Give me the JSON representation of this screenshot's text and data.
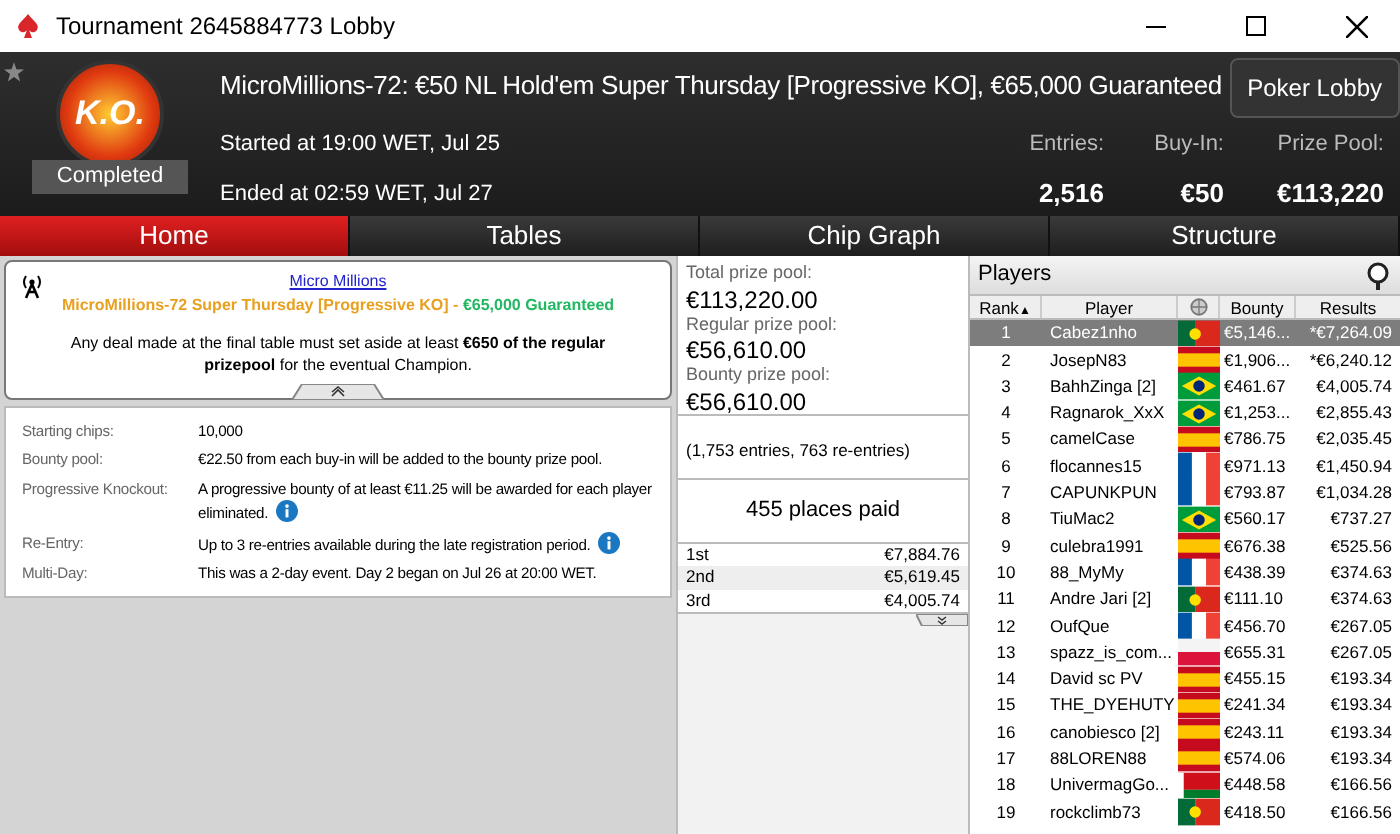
{
  "window": {
    "title": "Tournament 2645884773 Lobby"
  },
  "header": {
    "badge": "K.O.",
    "status": "Completed",
    "title": "MicroMillions-72: €50 NL Hold'em Super Thursday [Progressive KO], €65,000 Guaranteed",
    "started": "Started at 19:00 WET, Jul 25",
    "ended": "Ended at 02:59 WET, Jul 27",
    "lobby_button": "Poker Lobby",
    "stats": [
      {
        "label": "Entries:",
        "value": "2,516"
      },
      {
        "label": "Buy-In:",
        "value": "€50"
      },
      {
        "label": "Prize Pool:",
        "value": "€113,220"
      }
    ]
  },
  "tabs": [
    {
      "label": "Home",
      "selected": true
    },
    {
      "label": "Tables",
      "selected": false
    },
    {
      "label": "Chip Graph",
      "selected": false
    },
    {
      "label": "Structure",
      "selected": false
    }
  ],
  "banner": {
    "link": "Micro Millions",
    "name": "MicroMillions-72 Super Thursday [Progressive KO]",
    "separator": " - ",
    "guarantee": "€65,000 Guaranteed",
    "note": "Any deal made at the final table must set aside at least **€650 of the regular prizepool** for the eventual Champion."
  },
  "details": [
    {
      "label": "Starting chips:",
      "value": "10,000",
      "info": false
    },
    {
      "label": "Bounty pool:",
      "value": "€22.50 from each buy-in will be added to the bounty prize pool.",
      "info": false
    },
    {
      "label": "Progressive Knockout:",
      "value": "A progressive bounty of at least €11.25 will be awarded for each player eliminated.",
      "info": true
    },
    {
      "label": "Re-Entry:",
      "value": "Up to 3 re-entries available during the late registration period.",
      "info": true
    },
    {
      "label": "Multi-Day:",
      "value": "This was a 2-day event. Day 2 began on Jul 26 at 20:00 WET.",
      "info": false
    }
  ],
  "prizes": {
    "pools": [
      {
        "label": "Total prize pool:",
        "value": "€113,220.00"
      },
      {
        "label": "Regular prize pool:",
        "value": "€56,610.00"
      },
      {
        "label": "Bounty prize pool:",
        "value": "€56,610.00"
      }
    ],
    "entries_note": "(1,753 entries, 763 re-entries)",
    "places_paid": "455 places paid",
    "payouts": [
      {
        "place": "1st",
        "amount": "€7,884.76"
      },
      {
        "place": "2nd",
        "amount": "€5,619.45"
      },
      {
        "place": "3rd",
        "amount": "€4,005.74"
      }
    ]
  },
  "players": {
    "title": "Players",
    "columns": [
      "Rank",
      "Player",
      "Bounty",
      "Results"
    ],
    "sort_indicator": "▲",
    "rows": [
      {
        "rank": "1",
        "name": "Cabez1nho",
        "kind": "pt",
        "bounty": "€5,146...",
        "result": "*€7,264.09",
        "selected": true
      },
      {
        "rank": "2",
        "name": "JosepN83",
        "kind": "es",
        "bounty": "€1,906...",
        "result": "*€6,240.12",
        "selected": false
      },
      {
        "rank": "3",
        "name": "BahhZinga [2]",
        "kind": "br",
        "bounty": "€461.67",
        "result": "€4,005.74",
        "selected": false
      },
      {
        "rank": "4",
        "name": "Ragnarok_XxX",
        "kind": "br",
        "bounty": "€1,253...",
        "result": "€2,855.43",
        "selected": false
      },
      {
        "rank": "5",
        "name": "camelCase",
        "kind": "es",
        "bounty": "€786.75",
        "result": "€2,035.45",
        "selected": false
      },
      {
        "rank": "6",
        "name": "flocannes15",
        "kind": "fr",
        "bounty": "€971.13",
        "result": "€1,450.94",
        "selected": false
      },
      {
        "rank": "7",
        "name": "CAPUNKPUN",
        "kind": "fr",
        "bounty": "€793.87",
        "result": "€1,034.28",
        "selected": false
      },
      {
        "rank": "8",
        "name": "TiuMac2",
        "kind": "br",
        "bounty": "€560.17",
        "result": "€737.27",
        "selected": false
      },
      {
        "rank": "9",
        "name": "culebra1991",
        "kind": "es",
        "bounty": "€676.38",
        "result": "€525.56",
        "selected": false
      },
      {
        "rank": "10",
        "name": "88_MyMy",
        "kind": "fr",
        "bounty": "€438.39",
        "result": "€374.63",
        "selected": false
      },
      {
        "rank": "11",
        "name": "Andre Jari [2]",
        "kind": "pt",
        "bounty": "€111.10",
        "result": "€374.63",
        "selected": false
      },
      {
        "rank": "12",
        "name": "OufQue",
        "kind": "fr",
        "bounty": "€456.70",
        "result": "€267.05",
        "selected": false
      },
      {
        "rank": "13",
        "name": "spazz_is_com...",
        "kind": "pl",
        "bounty": "€655.31",
        "result": "€267.05",
        "selected": false
      },
      {
        "rank": "14",
        "name": "David sc PV",
        "kind": "es",
        "bounty": "€455.15",
        "result": "€193.34",
        "selected": false
      },
      {
        "rank": "15",
        "name": "THE_DYEHUTY",
        "kind": "es",
        "bounty": "€241.34",
        "result": "€193.34",
        "selected": false
      },
      {
        "rank": "16",
        "name": "canobiesco [2]",
        "kind": "es",
        "bounty": "€243.11",
        "result": "€193.34",
        "selected": false
      },
      {
        "rank": "17",
        "name": "88LOREN88",
        "kind": "es",
        "bounty": "€574.06",
        "result": "€193.34",
        "selected": false
      },
      {
        "rank": "18",
        "name": "UnivermagGo...",
        "kind": "by",
        "bounty": "€448.58",
        "result": "€166.56",
        "selected": false
      },
      {
        "rank": "19",
        "name": "rockclimb73",
        "kind": "pt",
        "bounty": "€418.50",
        "result": "€166.56",
        "selected": false
      }
    ]
  }
}
